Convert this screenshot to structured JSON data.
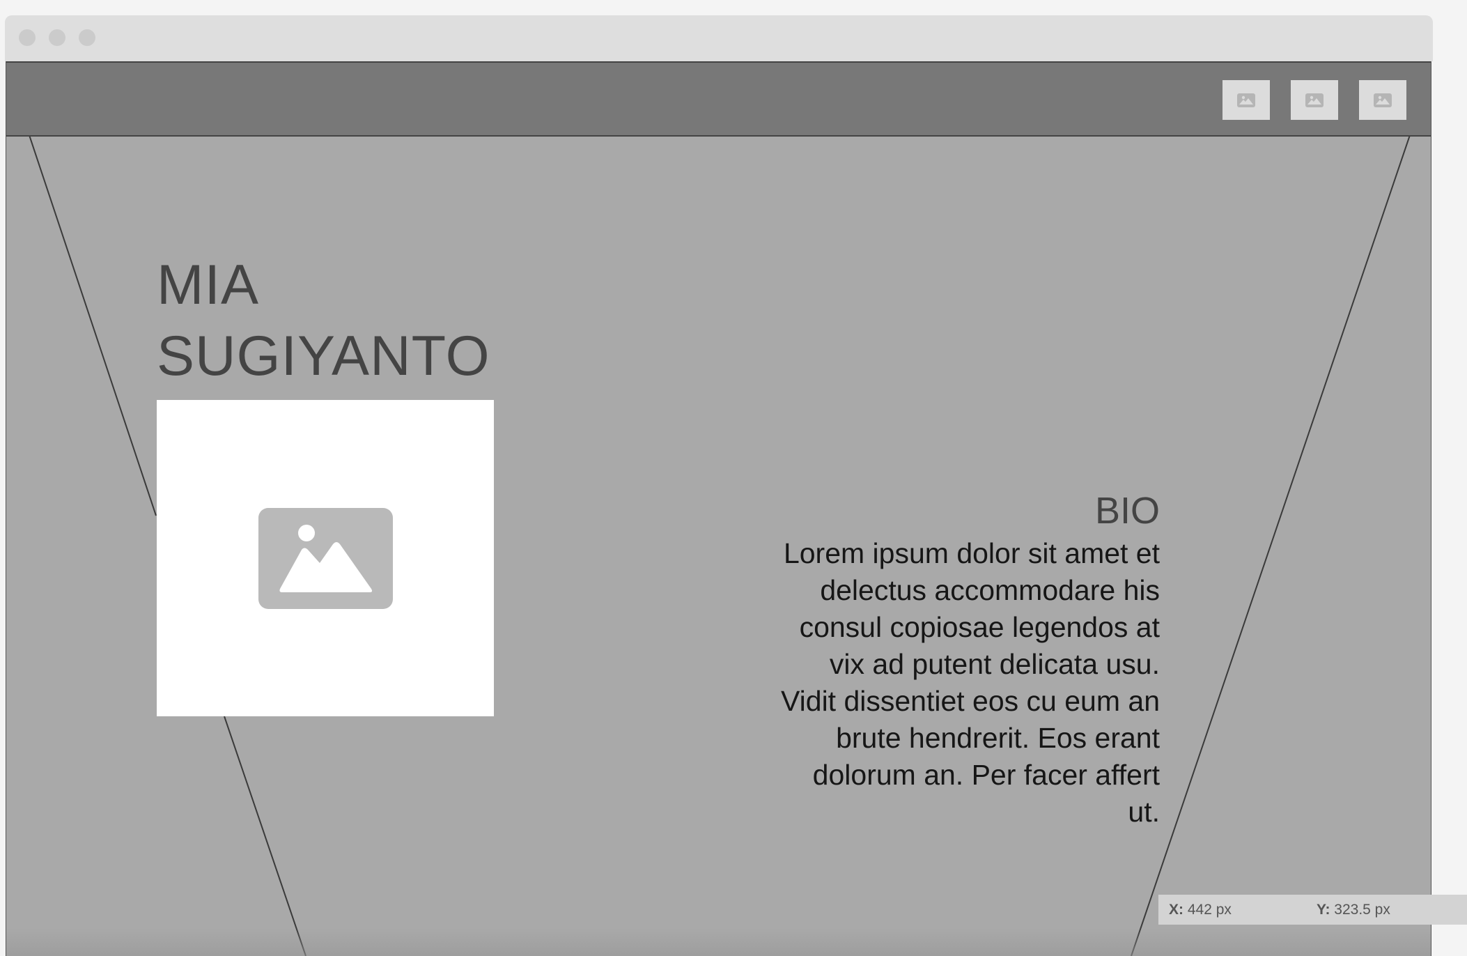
{
  "window": {
    "controls": [
      "close",
      "minimize",
      "maximize"
    ]
  },
  "header": {
    "icons": [
      "image-icon",
      "image-icon",
      "image-icon"
    ]
  },
  "hero": {
    "name": "MIA\nSUGIYANTO",
    "photo_icon": "image-placeholder-icon"
  },
  "bio": {
    "title": "BIO",
    "text": "Lorem ipsum dolor sit amet et delectus accommodare his consul copiosae legendos at vix ad putent delicata usu. Vidit dissentiet eos cu eum an brute hendrerit. Eos erant dolorum an. Per facer affert ut."
  },
  "coordinates": {
    "x_label": "X:",
    "x_value": "442 px",
    "y_label": "Y:",
    "y_value": "323.5 px"
  },
  "colors": {
    "page_bg": "#a9a9a9",
    "header_bg": "#787878",
    "heading": "#444444",
    "body_text": "#161616"
  }
}
